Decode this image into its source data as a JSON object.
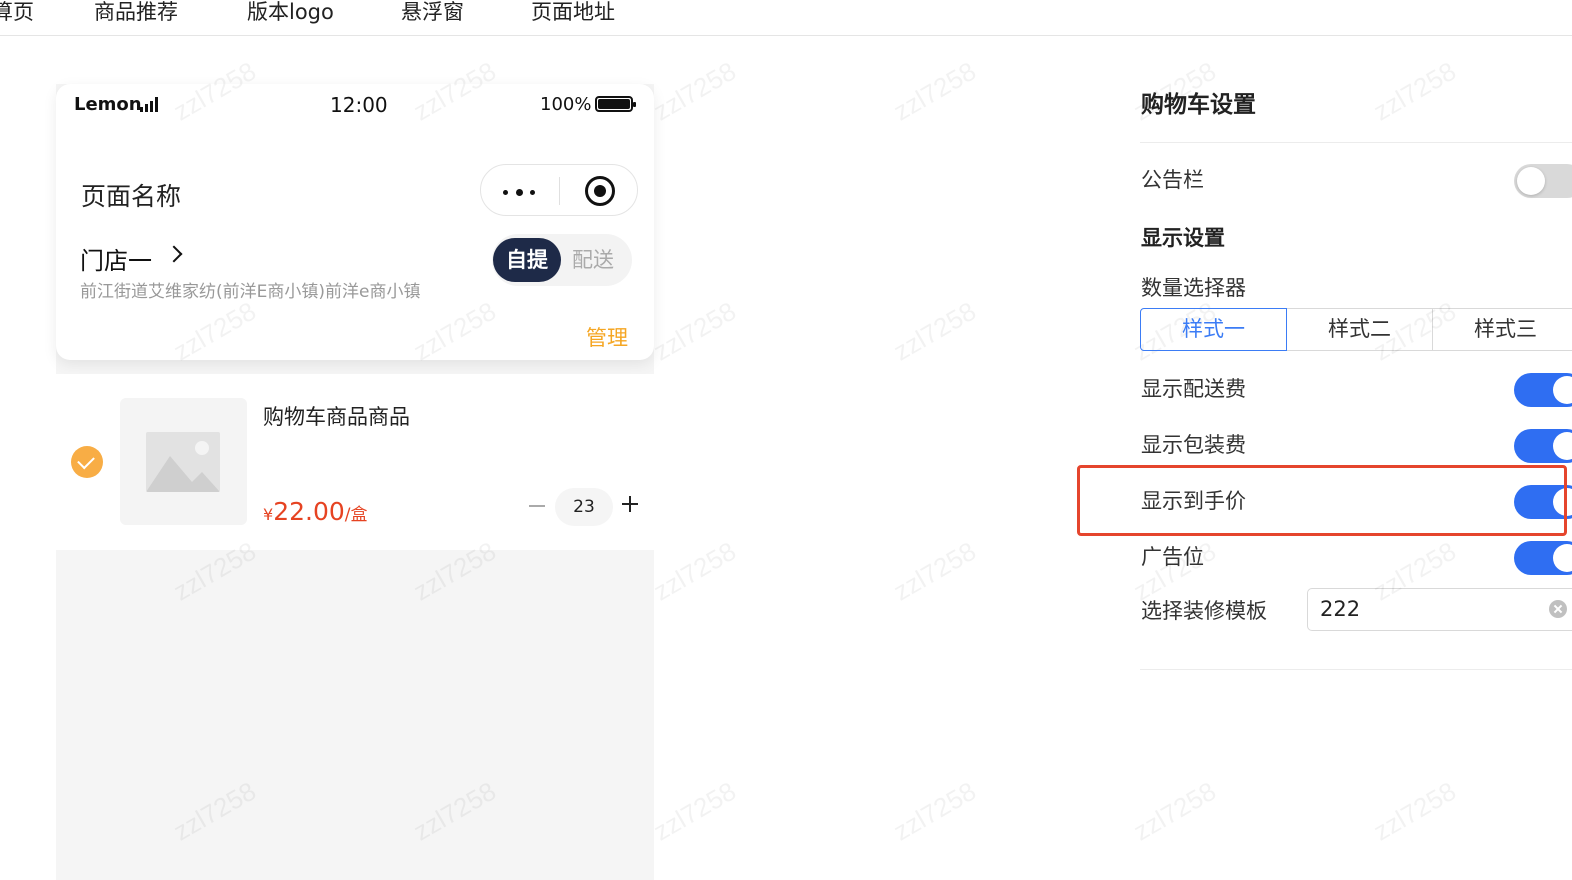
{
  "topnav": {
    "tabs": [
      {
        "label": "算页"
      },
      {
        "label": "商品推荐"
      },
      {
        "label": "版本logo"
      },
      {
        "label": "悬浮窗"
      },
      {
        "label": "页面地址"
      }
    ]
  },
  "watermark": "zzl7258",
  "phone": {
    "status": {
      "carrier": "Lemon",
      "time": "12:00",
      "battery": "100%"
    },
    "page_title": "页面名称",
    "capsule": {
      "more_icon": "more-dots-icon",
      "close_icon": "target-icon"
    },
    "store": {
      "name": "门店一",
      "address": "前江街道艾维家纺(前洋E商小镇)前洋e商小镇",
      "pickup_label": "自提",
      "delivery_label": "配送",
      "manage_label": "管理"
    },
    "cart_item": {
      "name": "购物车商品商品",
      "currency": "¥",
      "price": "22.00",
      "unit": "/盒",
      "quantity": "23"
    }
  },
  "settings": {
    "title": "购物车设置",
    "notice_bar": {
      "label": "公告栏",
      "enabled": false
    },
    "display_section": "显示设置",
    "qty_selector": {
      "label": "数量选择器",
      "options": [
        "样式一",
        "样式二",
        "样式三"
      ],
      "selected": "样式一"
    },
    "show_delivery_fee": {
      "label": "显示配送费",
      "enabled": true
    },
    "show_packaging_fee": {
      "label": "显示包装费",
      "enabled": true
    },
    "show_final_price": {
      "label": "显示到手价",
      "enabled": true
    },
    "ad_slot": {
      "label": "广告位",
      "enabled": true
    },
    "template": {
      "label": "选择装修模板",
      "value": "222"
    }
  },
  "colors": {
    "accent": "#2f6ef2",
    "orange": "#f5a623",
    "price_red": "#e64322",
    "pickup_dark": "#1e2a48",
    "highlight": "#e5452d"
  }
}
